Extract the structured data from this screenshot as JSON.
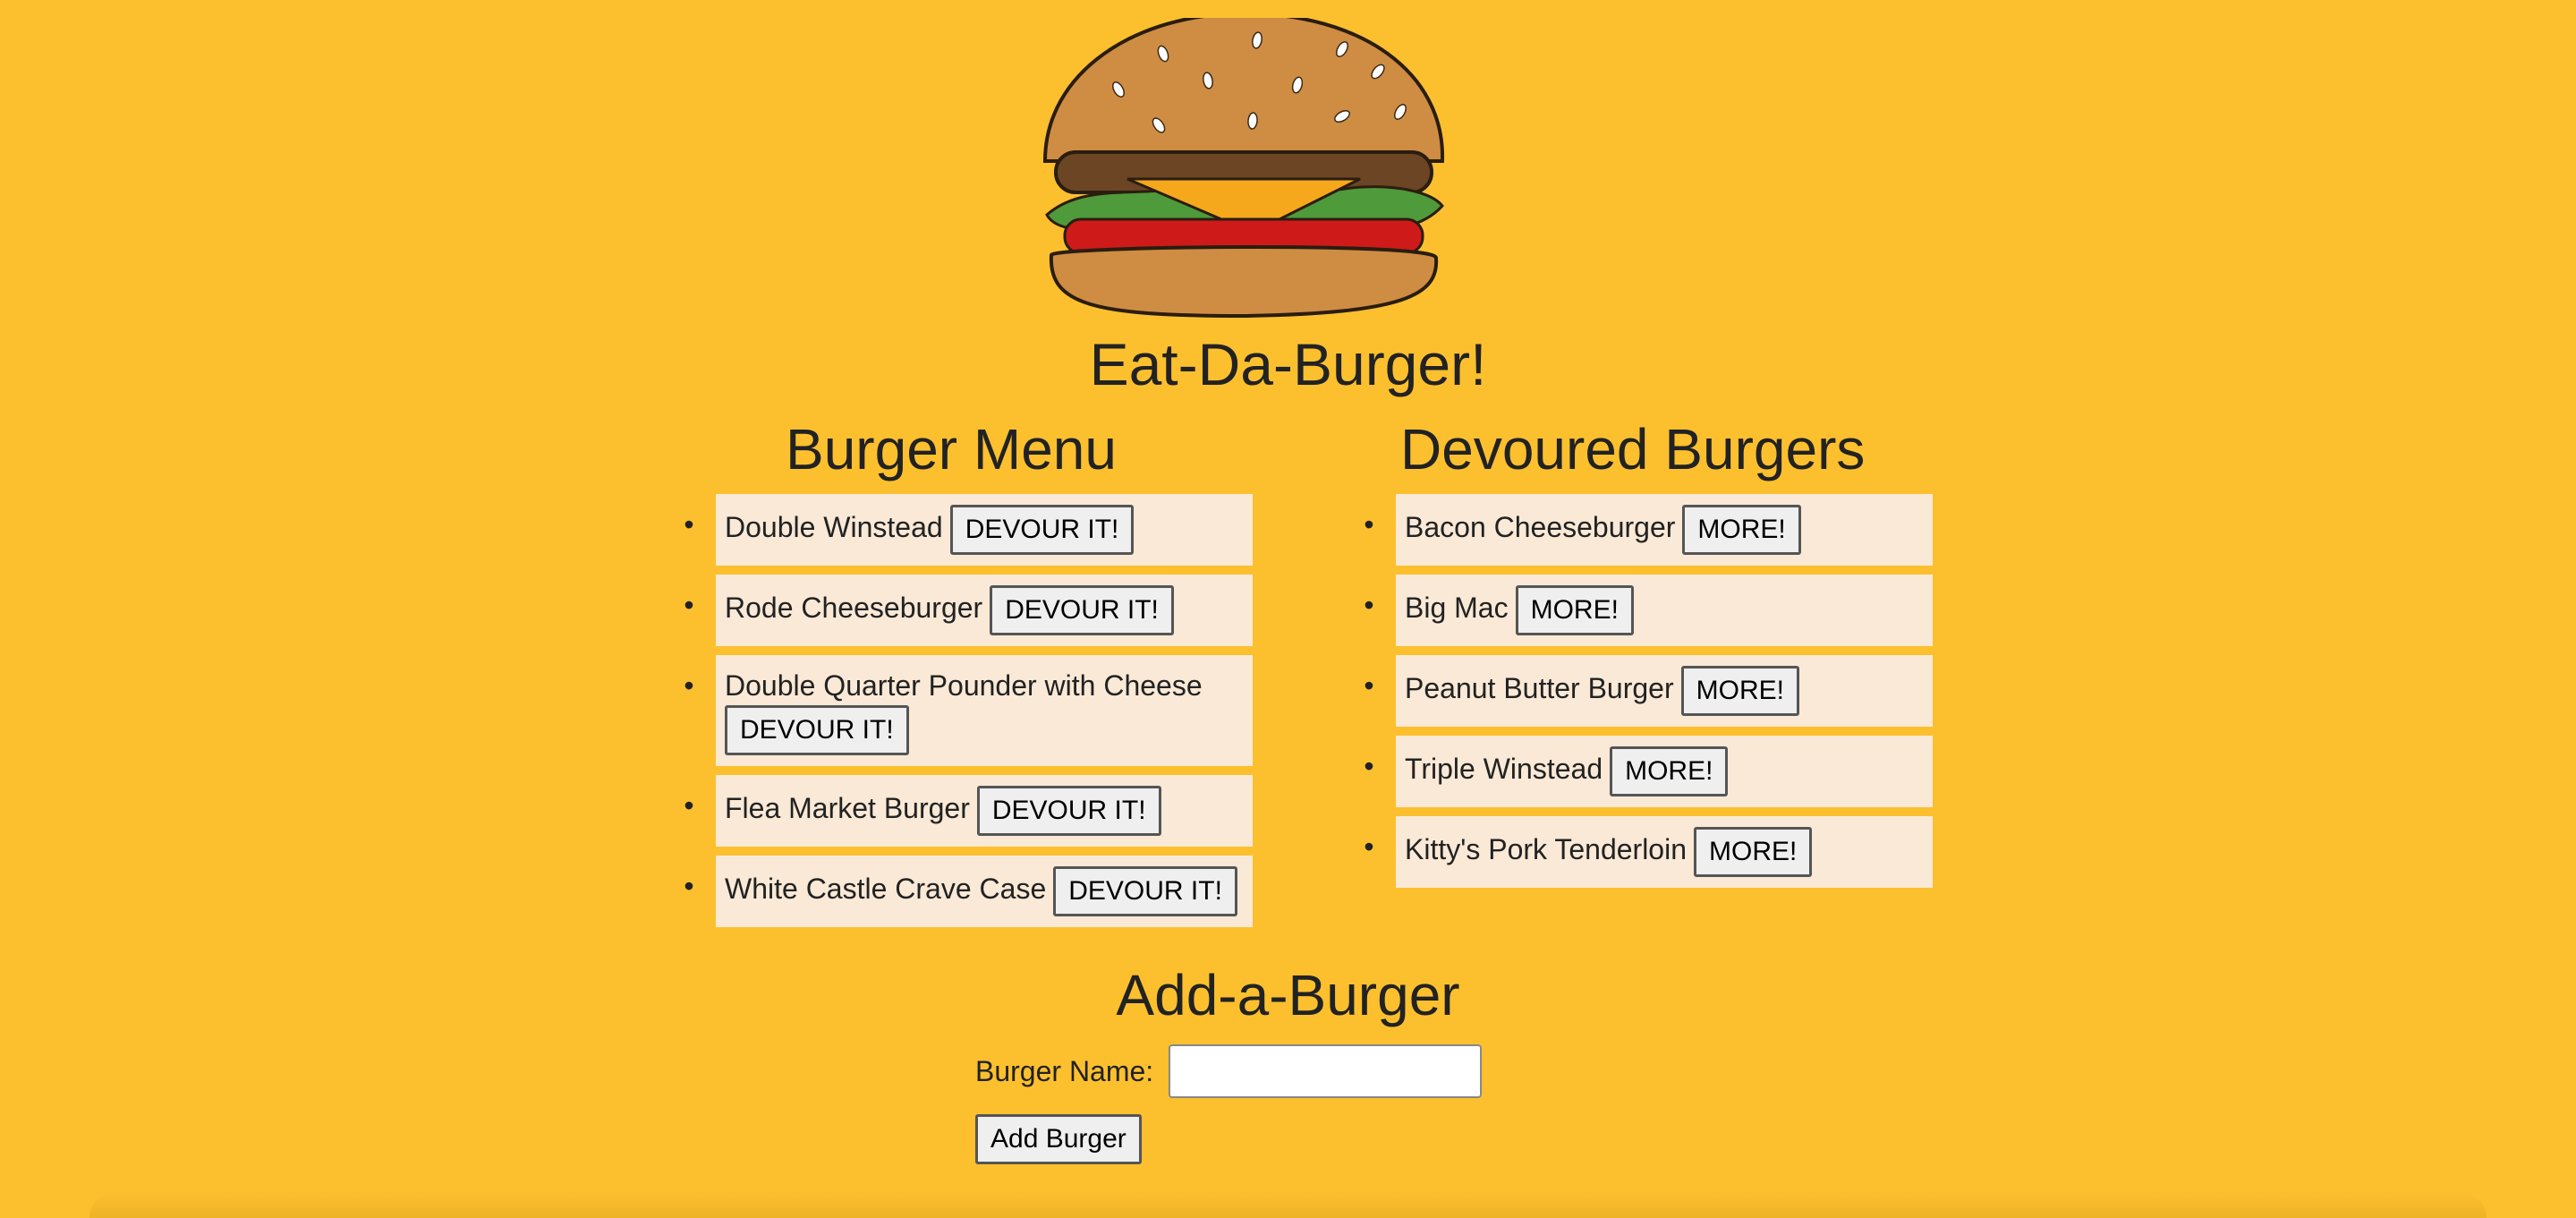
{
  "header": {
    "logo_icon": "burger-icon",
    "title": "Eat-Da-Burger!"
  },
  "menu": {
    "heading": "Burger Menu",
    "button_label": "DEVOUR IT!",
    "items": [
      {
        "name": "Double Winstead"
      },
      {
        "name": "Rode Cheeseburger"
      },
      {
        "name": "Double Quarter Pounder with Cheese"
      },
      {
        "name": "Flea Market Burger"
      },
      {
        "name": "White Castle Crave Case"
      }
    ]
  },
  "devoured": {
    "heading": "Devoured Burgers",
    "button_label": "MORE!",
    "items": [
      {
        "name": "Bacon Cheeseburger"
      },
      {
        "name": "Big Mac"
      },
      {
        "name": "Peanut Butter Burger"
      },
      {
        "name": "Triple Winstead"
      },
      {
        "name": "Kitty's Pork Tenderloin"
      }
    ]
  },
  "add_form": {
    "heading": "Add-a-Burger",
    "label": "Burger Name:",
    "value": "",
    "submit_label": "Add Burger"
  },
  "colors": {
    "background": "#fcc02f",
    "item_background": "#f9e9d6"
  }
}
